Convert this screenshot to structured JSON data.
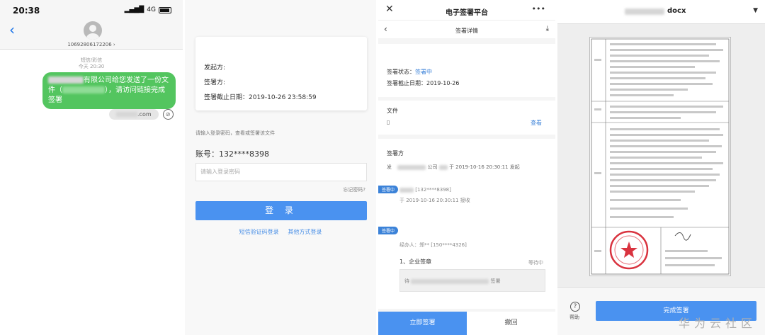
{
  "sms": {
    "time": "20:38",
    "network": "4G",
    "sender_number": "10692806172206 ›",
    "meta_line1": "短信/彩信",
    "meta_line2": "今天 20:30",
    "message_part1": "有限公司给您发送了一份文件（",
    "message_part2": "），请访问链接完成签署",
    "link_domain": ".com"
  },
  "login": {
    "initiator_label": "发起方:",
    "signer_label": "签署方:",
    "deadline": "签署截止日期：2019-10-26 23:58:59",
    "hint": "请输入登录密码，查看或签署该文件",
    "account": "账号：132****8398",
    "password_placeholder": "请输入登录密码",
    "forgot": "忘记密码?",
    "login_button": "登 录",
    "sms_login": "短信验证码登录",
    "other_login": "其他方式登录"
  },
  "detail": {
    "app_title": "电子签署平台",
    "page_title": "签署详情",
    "status_label": "签署状态：",
    "status_value": "签署中",
    "deadline": "签署截止日期：2019-10-26",
    "file_label": "文件",
    "view_link": "查看",
    "signers_label": "签署方",
    "initiator_short": "发",
    "company_label": "公司 ",
    "initiated_time": "于 2019-10-16 20:30:11 发起",
    "tag1": "签署中",
    "phone1": "[132****8398]",
    "received_time": "于 2019-10-16 20:30:11 接收",
    "tag2": "签署中",
    "handler": "经办人：郑** [150****4326]",
    "corp_sign": "1、企业签章",
    "waiting": "等待中",
    "pending_text": "待",
    "pending_suffix": "签署",
    "sign_now": "立即签署",
    "revoke": "撤回"
  },
  "document": {
    "filename": "docx",
    "help": "帮助",
    "complete": "完成签署",
    "watermark": "华为云社区"
  }
}
